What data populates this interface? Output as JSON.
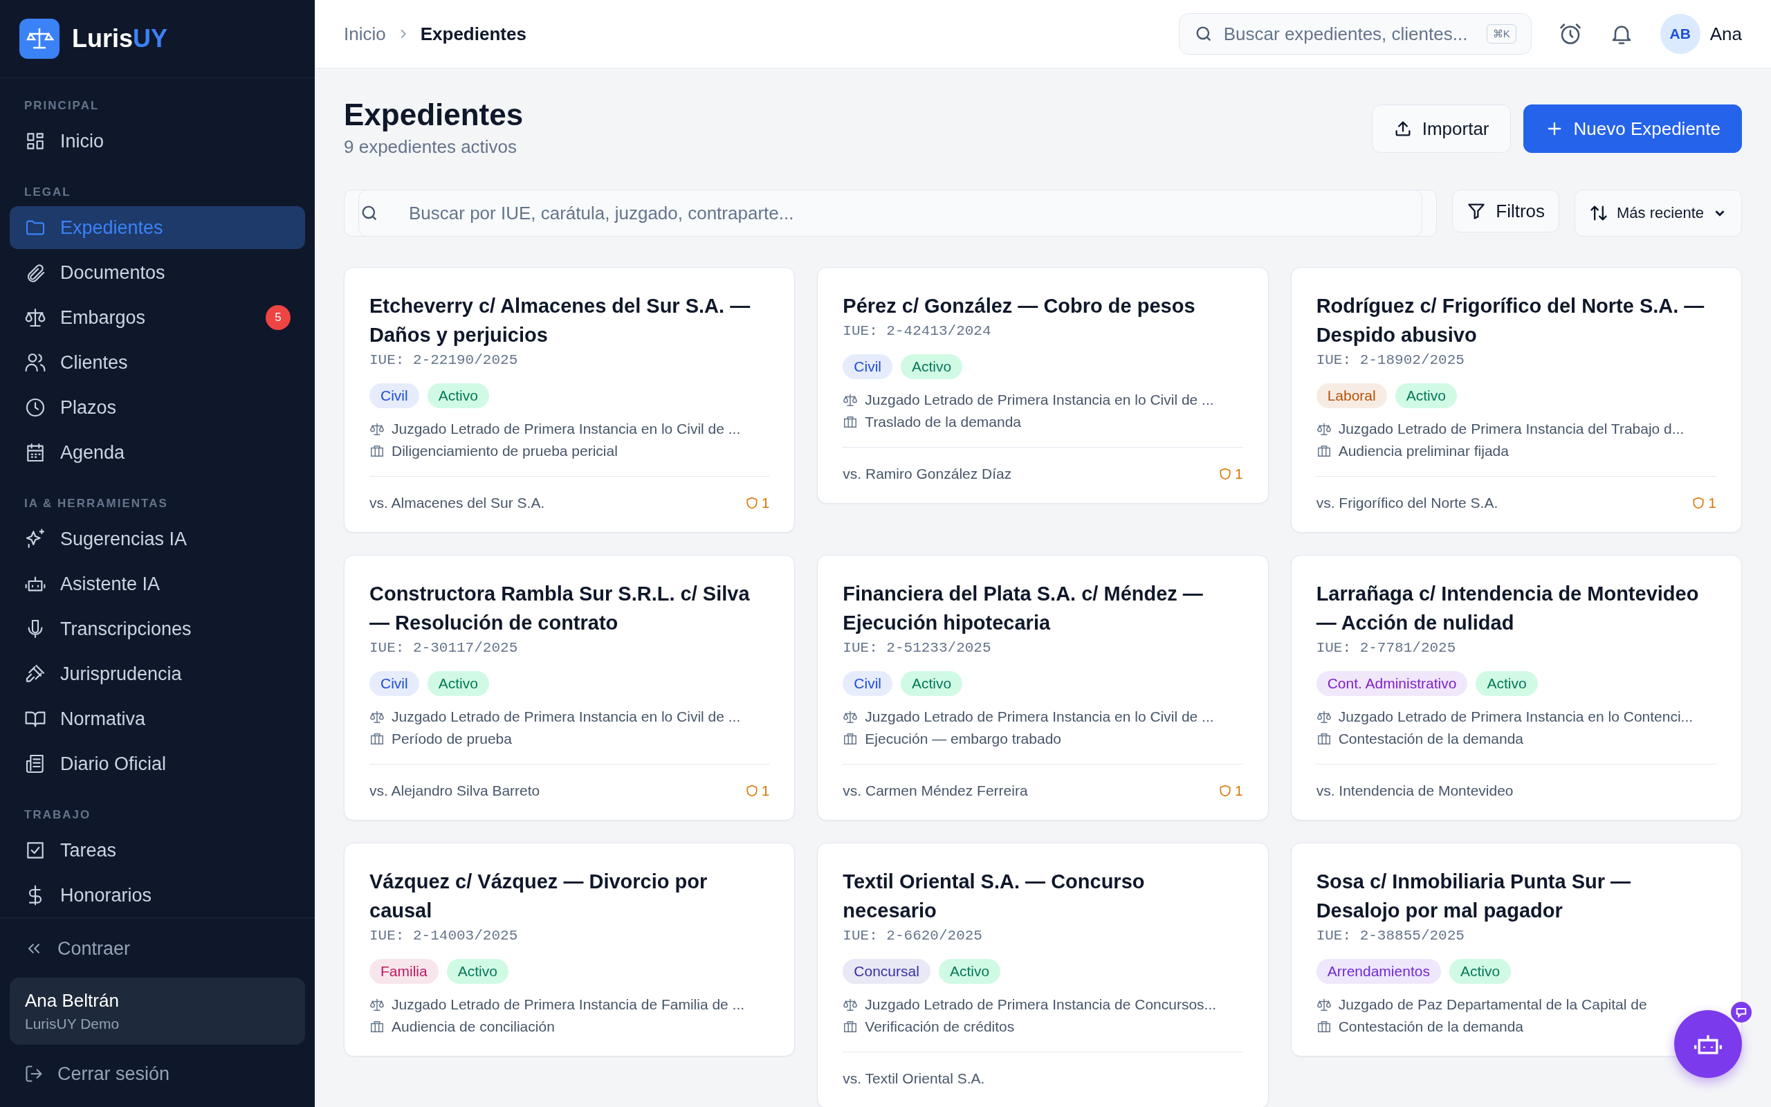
{
  "sidebar": {
    "brand": {
      "name": "Luris",
      "accent": "UY"
    },
    "sections": [
      {
        "label": "PRINCIPAL",
        "items": [
          {
            "label": "Inicio",
            "selected": false
          }
        ]
      },
      {
        "label": "LEGAL",
        "items": [
          {
            "label": "Expedientes",
            "selected": true
          },
          {
            "label": "Documentos",
            "selected": false
          },
          {
            "label": "Embargos",
            "selected": false,
            "badge": "5"
          },
          {
            "label": "Clientes",
            "selected": false
          },
          {
            "label": "Plazos",
            "selected": false
          },
          {
            "label": "Agenda",
            "selected": false
          }
        ]
      },
      {
        "label": "IA & HERRAMIENTAS",
        "items": [
          {
            "label": "Sugerencias IA",
            "selected": false
          },
          {
            "label": "Asistente IA",
            "selected": false
          },
          {
            "label": "Transcripciones",
            "selected": false
          },
          {
            "label": "Jurisprudencia",
            "selected": false
          },
          {
            "label": "Normativa",
            "selected": false
          },
          {
            "label": "Diario Oficial",
            "selected": false
          }
        ]
      },
      {
        "label": "TRABAJO",
        "items": [
          {
            "label": "Tareas",
            "selected": false
          },
          {
            "label": "Honorarios",
            "selected": false
          }
        ]
      }
    ],
    "collapse": "Contraer",
    "user": {
      "name": "Ana Beltrán",
      "org": "LurisUY Demo"
    },
    "logout": "Cerrar sesión"
  },
  "header": {
    "breadcrumb": [
      "Inicio",
      "Expedientes"
    ],
    "search": {
      "placeholder": "Buscar expedientes, clientes...",
      "shortcut": "⌘K"
    },
    "avatar": "AB",
    "user": "Ana"
  },
  "page": {
    "title": "Expedientes",
    "subtitle": "9 expedientes activos",
    "import_button": "Importar",
    "new_button": "Nuevo Expediente",
    "search": {
      "placeholder": "Buscar por IUE, carátula, juzgado, contraparte..."
    },
    "filters_button": "Filtros",
    "sort": "Más reciente"
  },
  "cards": [
    {
      "title": "Etcheverry c/ Almacenes del Sur S.A. — Daños y perjuicios",
      "iue": "IUE: 2-22190/2025",
      "area": {
        "label": "Civil",
        "color": "#1d4ed8"
      },
      "status": "Activo",
      "court": "Juzgado Letrado de Primera Instancia en lo Civil de ...",
      "stage": "Diligenciamiento de prueba pericial",
      "counterparty": "vs. Almacenes del Sur S.A.",
      "alerts": "1"
    },
    {
      "title": "Pérez c/ González — Cobro de pesos",
      "iue": "IUE: 2-42413/2024",
      "area": {
        "label": "Civil",
        "color": "#1d4ed8"
      },
      "status": "Activo",
      "court": "Juzgado Letrado de Primera Instancia en lo Civil de ...",
      "stage": "Traslado de la demanda",
      "counterparty": "vs. Ramiro González Díaz",
      "alerts": "1"
    },
    {
      "title": "Rodríguez c/ Frigorífico del Norte S.A. — Despido abusivo",
      "iue": "IUE: 2-18902/2025",
      "area": {
        "label": "Laboral",
        "color": "#b45309"
      },
      "status": "Activo",
      "court": "Juzgado Letrado de Primera Instancia del Trabajo d...",
      "stage": "Audiencia preliminar fijada",
      "counterparty": "vs. Frigorífico del Norte S.A.",
      "alerts": "1"
    },
    {
      "title": "Constructora Rambla Sur S.R.L. c/ Silva — Resolución de contrato",
      "iue": "IUE: 2-30117/2025",
      "area": {
        "label": "Civil",
        "color": "#1d4ed8"
      },
      "status": "Activo",
      "court": "Juzgado Letrado de Primera Instancia en lo Civil de ...",
      "stage": "Período de prueba",
      "counterparty": "vs. Alejandro Silva Barreto",
      "alerts": "1"
    },
    {
      "title": "Financiera del Plata S.A. c/ Méndez — Ejecución hipotecaria",
      "iue": "IUE: 2-51233/2025",
      "area": {
        "label": "Civil",
        "color": "#1d4ed8"
      },
      "status": "Activo",
      "court": "Juzgado Letrado de Primera Instancia en lo Civil de ...",
      "stage": "Ejecución — embargo trabado",
      "counterparty": "vs. Carmen Méndez Ferreira",
      "alerts": "1"
    },
    {
      "title": "Larrañaga c/ Intendencia de Montevideo — Acción de nulidad",
      "iue": "IUE: 2-7781/2025",
      "area": {
        "label": "Cont. Administrativo",
        "color": "#7e22ce"
      },
      "status": "Activo",
      "court": "Juzgado Letrado de Primera Instancia en lo Contenci...",
      "stage": "Contestación de la demanda",
      "counterparty": "vs. Intendencia de Montevideo"
    },
    {
      "title": "Vázquez c/ Vázquez — Divorcio por causal",
      "iue": "IUE: 2-14003/2025",
      "area": {
        "label": "Familia",
        "color": "#be185d"
      },
      "status": "Activo",
      "court": "Juzgado Letrado de Primera Instancia de Familia de ...",
      "stage": "Audiencia de conciliación"
    },
    {
      "title": "Textil Oriental S.A. — Concurso necesario",
      "iue": "IUE: 2-6620/2025",
      "area": {
        "label": "Concursal",
        "color": "#3730a3"
      },
      "status": "Activo",
      "court": "Juzgado Letrado de Primera Instancia de Concursos...",
      "stage": "Verificación de créditos",
      "counterparty": "vs. Textil Oriental S.A."
    },
    {
      "title": "Sosa c/ Inmobiliaria Punta Sur — Desalojo por mal pagador",
      "iue": "IUE: 2-38855/2025",
      "area": {
        "label": "Arrendamientos",
        "color": "#6d28d9"
      },
      "status": "Activo",
      "court": "Juzgado de Paz Departamental de la Capital de",
      "stage": "Contestación de la demanda"
    }
  ]
}
